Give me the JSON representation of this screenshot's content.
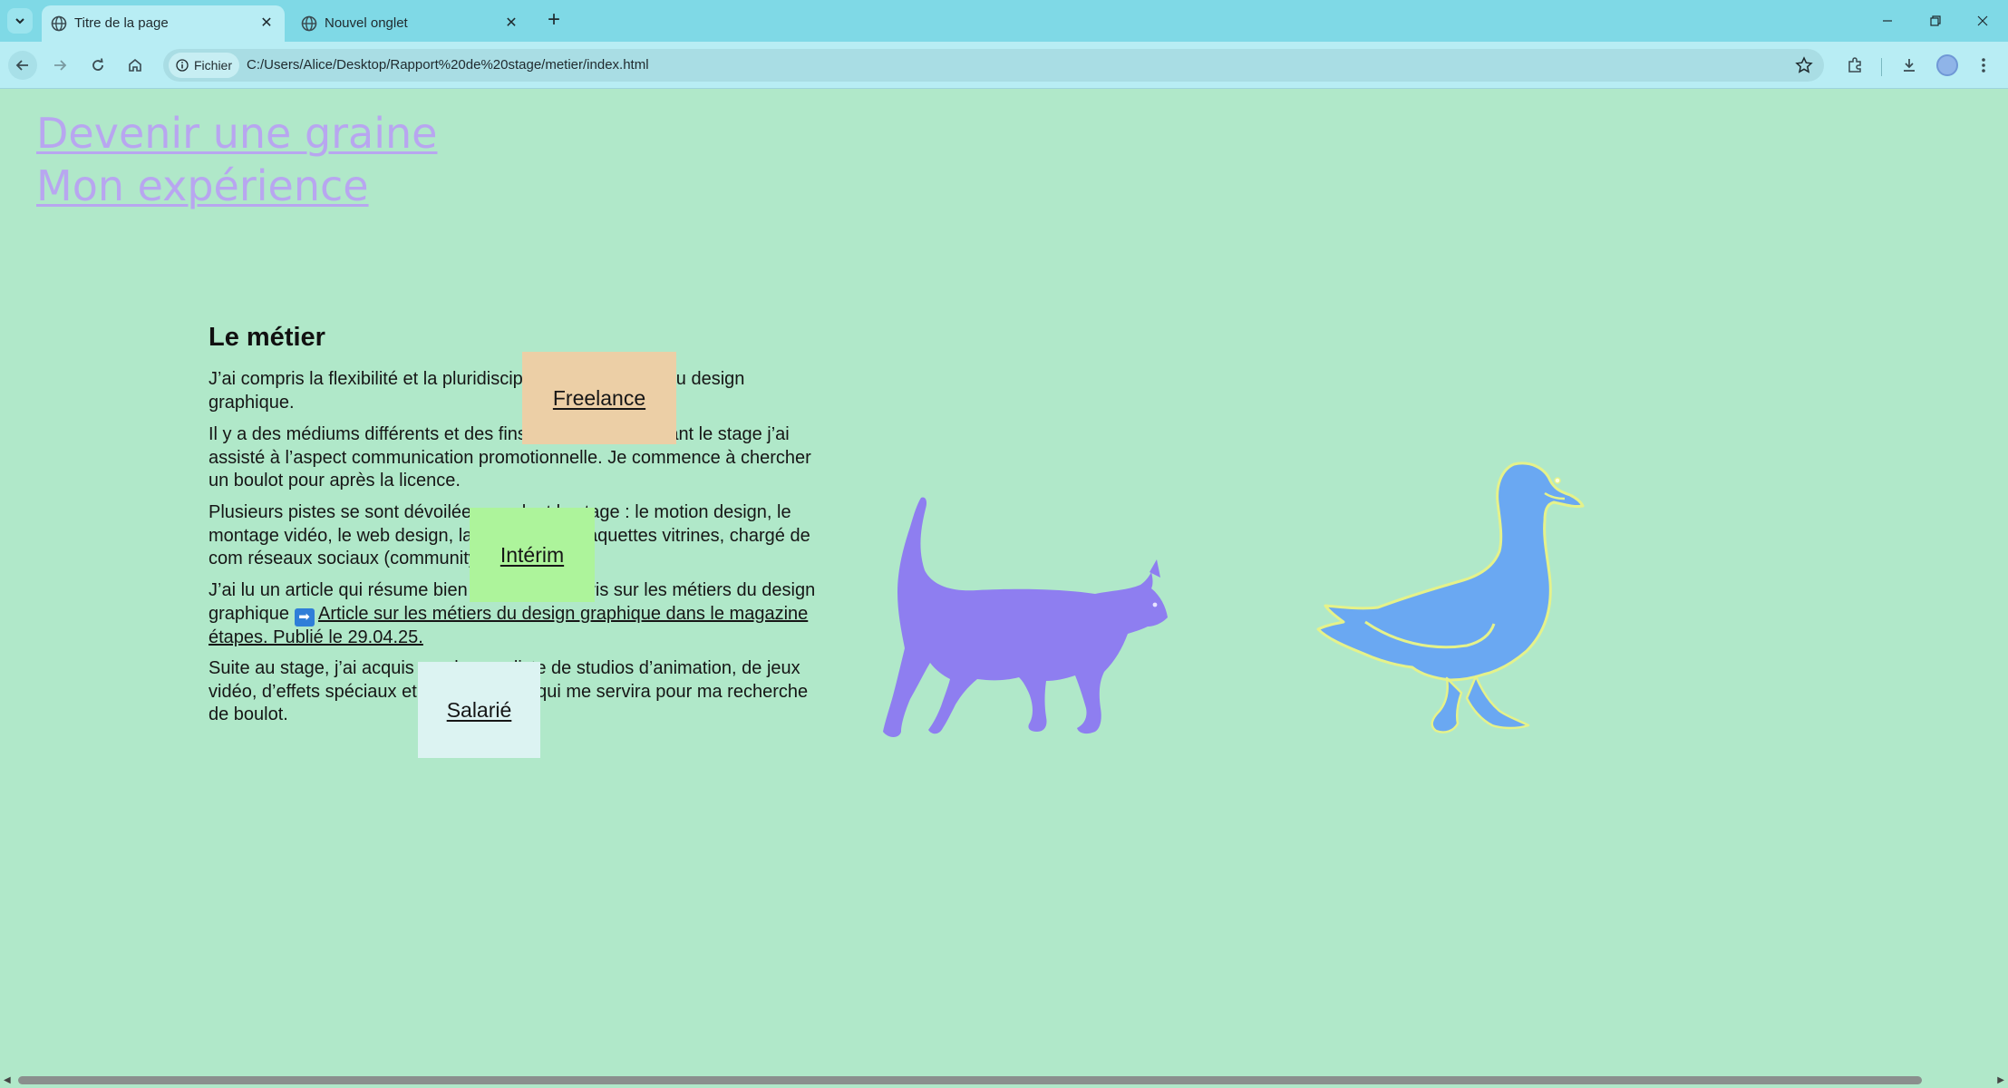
{
  "browser": {
    "tabs": [
      {
        "title": "Titre de la page",
        "active": true,
        "icon": "globe-icon"
      },
      {
        "title": "Nouvel onglet",
        "active": false,
        "icon": "globe-icon"
      }
    ],
    "new_tab": "+",
    "address": {
      "chip_label": "Fichier",
      "url": "C:/Users/Alice/Desktop/Rapport%20de%20stage/metier/index.html"
    }
  },
  "page": {
    "nav": [
      "Devenir une graine",
      "Mon expérience"
    ],
    "heading": "Le métier",
    "paragraphs": {
      "p1": "J’ai compris la flexibilité et la pluridisciplinarité du champ du design graphique.",
      "p2": "Il y a des médiums différents et des fins différentes. Pendant le stage j’ai assisté à l’aspect communication promotionnelle. Je commence à chercher un boulot pour après la licence.",
      "p3": "Plusieurs pistes se sont dévoilées pendant le stage : le motion design, le montage vidéo, le web design, la création de maquettes vitrines, chargé de com réseaux sociaux (community manager).",
      "p4_before": "J’ai lu un article qui résume bien ce que j’ai appris sur les métiers du design graphique ",
      "p4_link": "Article sur les métiers du design graphique dans le magazine étapes. Publié le 29.04.25.",
      "p5": "Suite au stage, j’ai acquis une longue liste de studios d’animation, de jeux vidéo, d’effets spéciaux et de production qui me servira pour ma recherche de boulot."
    },
    "tags": {
      "freelance": "Freelance",
      "interim": "Intérim",
      "salarie": "Salarié"
    },
    "colors": {
      "background": "#b0e8c9",
      "link": "#b8a6f0",
      "freelance": "#eccfa6",
      "interim": "#adf49b",
      "salarie": "#dcf3f2",
      "cat": "#8e7ef0",
      "duck": "#6aa8f2"
    }
  }
}
